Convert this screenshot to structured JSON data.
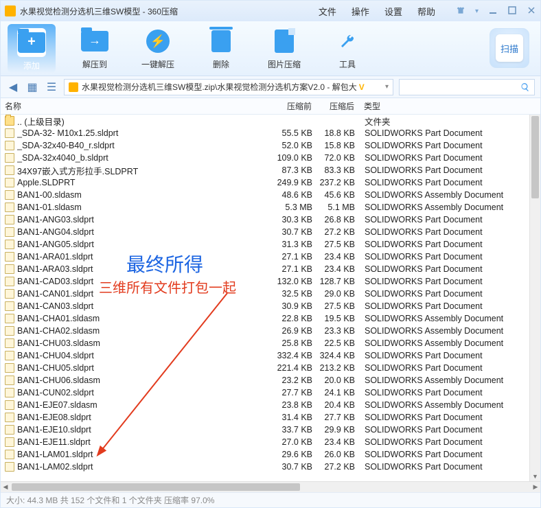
{
  "title": "水果视觉检测分选机三维SW模型 - 360压缩",
  "menu": {
    "file": "文件",
    "operate": "操作",
    "settings": "设置",
    "help": "帮助"
  },
  "toolbar": {
    "add": "添加",
    "extract_to": "解压到",
    "one_click": "一键解压",
    "delete": "删除",
    "img_compress": "图片压缩",
    "tools": "工具",
    "scan": "扫描"
  },
  "path": {
    "prefix_icon": "archive",
    "text_a": "水果视觉检测分选机三维SW模型.zip\\水果视觉检测分选机方案V2.0 - 解包大",
    "vip": "V"
  },
  "columns": {
    "name": "名称",
    "before": "压缩前",
    "after": "压缩后",
    "type": "类型"
  },
  "type_folder": "文件夹",
  "rows": [
    {
      "name": ".. (上级目录)",
      "before": "",
      "after": "",
      "type": "文件夹",
      "folder": true
    },
    {
      "name": "_SDA-32- M10x1.25.sldprt",
      "before": "55.5 KB",
      "after": "18.8 KB",
      "type": "SOLIDWORKS Part Document"
    },
    {
      "name": "_SDA-32x40-B40_r.sldprt",
      "before": "52.0 KB",
      "after": "15.8 KB",
      "type": "SOLIDWORKS Part Document"
    },
    {
      "name": "_SDA-32x4040_b.sldprt",
      "before": "109.0 KB",
      "after": "72.0 KB",
      "type": "SOLIDWORKS Part Document"
    },
    {
      "name": "34X97嵌入式方形拉手.SLDPRT",
      "before": "87.3 KB",
      "after": "83.3 KB",
      "type": "SOLIDWORKS Part Document"
    },
    {
      "name": "Apple.SLDPRT",
      "before": "249.9 KB",
      "after": "237.2 KB",
      "type": "SOLIDWORKS Part Document"
    },
    {
      "name": "BAN1-00.sldasm",
      "before": "48.6 KB",
      "after": "45.6 KB",
      "type": "SOLIDWORKS Assembly Document"
    },
    {
      "name": "BAN1-01.sldasm",
      "before": "5.3 MB",
      "after": "5.1 MB",
      "type": "SOLIDWORKS Assembly Document"
    },
    {
      "name": "BAN1-ANG03.sldprt",
      "before": "30.3 KB",
      "after": "26.8 KB",
      "type": "SOLIDWORKS Part Document"
    },
    {
      "name": "BAN1-ANG04.sldprt",
      "before": "30.7 KB",
      "after": "27.2 KB",
      "type": "SOLIDWORKS Part Document"
    },
    {
      "name": "BAN1-ANG05.sldprt",
      "before": "31.3 KB",
      "after": "27.5 KB",
      "type": "SOLIDWORKS Part Document"
    },
    {
      "name": "BAN1-ARA01.sldprt",
      "before": "27.1 KB",
      "after": "23.4 KB",
      "type": "SOLIDWORKS Part Document"
    },
    {
      "name": "BAN1-ARA03.sldprt",
      "before": "27.1 KB",
      "after": "23.4 KB",
      "type": "SOLIDWORKS Part Document"
    },
    {
      "name": "BAN1-CAD03.sldprt",
      "before": "132.0 KB",
      "after": "128.7 KB",
      "type": "SOLIDWORKS Part Document"
    },
    {
      "name": "BAN1-CAN01.sldprt",
      "before": "32.5 KB",
      "after": "29.0 KB",
      "type": "SOLIDWORKS Part Document"
    },
    {
      "name": "BAN1-CAN03.sldprt",
      "before": "30.9 KB",
      "after": "27.5 KB",
      "type": "SOLIDWORKS Part Document"
    },
    {
      "name": "BAN1-CHA01.sldasm",
      "before": "22.8 KB",
      "after": "19.5 KB",
      "type": "SOLIDWORKS Assembly Document"
    },
    {
      "name": "BAN1-CHA02.sldasm",
      "before": "26.9 KB",
      "after": "23.3 KB",
      "type": "SOLIDWORKS Assembly Document"
    },
    {
      "name": "BAN1-CHU03.sldasm",
      "before": "25.8 KB",
      "after": "22.5 KB",
      "type": "SOLIDWORKS Assembly Document"
    },
    {
      "name": "BAN1-CHU04.sldprt",
      "before": "332.4 KB",
      "after": "324.4 KB",
      "type": "SOLIDWORKS Part Document"
    },
    {
      "name": "BAN1-CHU05.sldprt",
      "before": "221.4 KB",
      "after": "213.2 KB",
      "type": "SOLIDWORKS Part Document"
    },
    {
      "name": "BAN1-CHU06.sldasm",
      "before": "23.2 KB",
      "after": "20.0 KB",
      "type": "SOLIDWORKS Assembly Document"
    },
    {
      "name": "BAN1-CUN02.sldprt",
      "before": "27.7 KB",
      "after": "24.1 KB",
      "type": "SOLIDWORKS Part Document"
    },
    {
      "name": "BAN1-EJE07.sldasm",
      "before": "23.8 KB",
      "after": "20.4 KB",
      "type": "SOLIDWORKS Assembly Document"
    },
    {
      "name": "BAN1-EJE08.sldprt",
      "before": "31.4 KB",
      "after": "27.7 KB",
      "type": "SOLIDWORKS Part Document"
    },
    {
      "name": "BAN1-EJE10.sldprt",
      "before": "33.7 KB",
      "after": "29.9 KB",
      "type": "SOLIDWORKS Part Document"
    },
    {
      "name": "BAN1-EJE11.sldprt",
      "before": "27.0 KB",
      "after": "23.4 KB",
      "type": "SOLIDWORKS Part Document"
    },
    {
      "name": "BAN1-LAM01.sldprt",
      "before": "29.6 KB",
      "after": "26.0 KB",
      "type": "SOLIDWORKS Part Document"
    },
    {
      "name": "BAN1-LAM02.sldprt",
      "before": "30.7 KB",
      "after": "27.2 KB",
      "type": "SOLIDWORKS Part Document"
    }
  ],
  "annot": {
    "line1": "最终所得",
    "line2": "三维所有文件打包一起"
  },
  "status": "大小: 44.3 MB 共 152 个文件和 1 个文件夹 压缩率 97.0%"
}
